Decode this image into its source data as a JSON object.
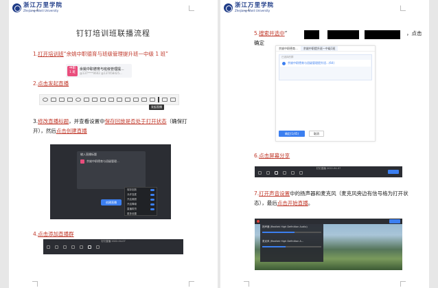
{
  "university": {
    "name_cn": "浙江万里学院",
    "name_en": "Zhejiang Wanli University"
  },
  "left_page": {
    "title": "钉钉培训班联播流程",
    "step1": {
      "num": "1.",
      "action": "打开培训班",
      "quote": "“余姚中职德育与班级管理提升班一中级 1 班”"
    },
    "group_card": {
      "avatar": "中职\n1班",
      "name": "余姚中职德育与班级管理提...",
      "sub": "@137****0602 @137058425..."
    },
    "step2": {
      "num": "2.",
      "text": "点击发起直播"
    },
    "toolbar_tip": "发起直播",
    "step3": {
      "num": "3.",
      "part1": "修改直播标题",
      "part2": "，并查看设置中",
      "part3": "保存回放是否处于打开状态",
      "part4": "（确保打",
      "line2a": "开），然后",
      "line2b": "点击创建直播"
    },
    "live_setup": {
      "title_placeholder": "输入直播标题",
      "group_row": "余姚中职德育与班级管理...",
      "create_button": "创建直播",
      "menu_items": [
        "保存回放",
        "允许连麦",
        "开启美颜",
        "开启降噪",
        "直播带货",
        "更多设置"
      ]
    },
    "step4": {
      "num": "4.",
      "text": "点击添加直播群"
    },
    "live_bar_time": "钉钉直播 2022-04-07"
  },
  "right_page": {
    "step5": {
      "num": "5.",
      "text": "搜索并选中",
      "quote": "“",
      "suffix": "，点击",
      "line2": "确定"
    },
    "dialog": {
      "tab1": "余姚中职德育...",
      "tab2": "余姚中职提升班一中级1班",
      "list_label": "已选择的群",
      "item": "余姚中职德育与班级管理提升班...(64)",
      "ok_button": "确定(1/45)",
      "cancel_button": "取消"
    },
    "step6": {
      "num": "6.",
      "text": "点击屏幕分享"
    },
    "share_bar_time": "钉钉直播 2022-04-07",
    "step7": {
      "num": "7.",
      "part1": "打开声音设置",
      "part2": "中的扬声器和麦克风（麦克风旁边有信号格为打开状",
      "line2a": "态），最后",
      "line2b": "点击开始直播",
      "line2c": "。"
    },
    "audio_panel": {
      "speaker": "扬声器 (Realtek High Definition Audio)",
      "mic": "麦克风 (Realtek High Definition A...",
      "speaker_level": 0.55,
      "mic_level": 0.4
    }
  }
}
